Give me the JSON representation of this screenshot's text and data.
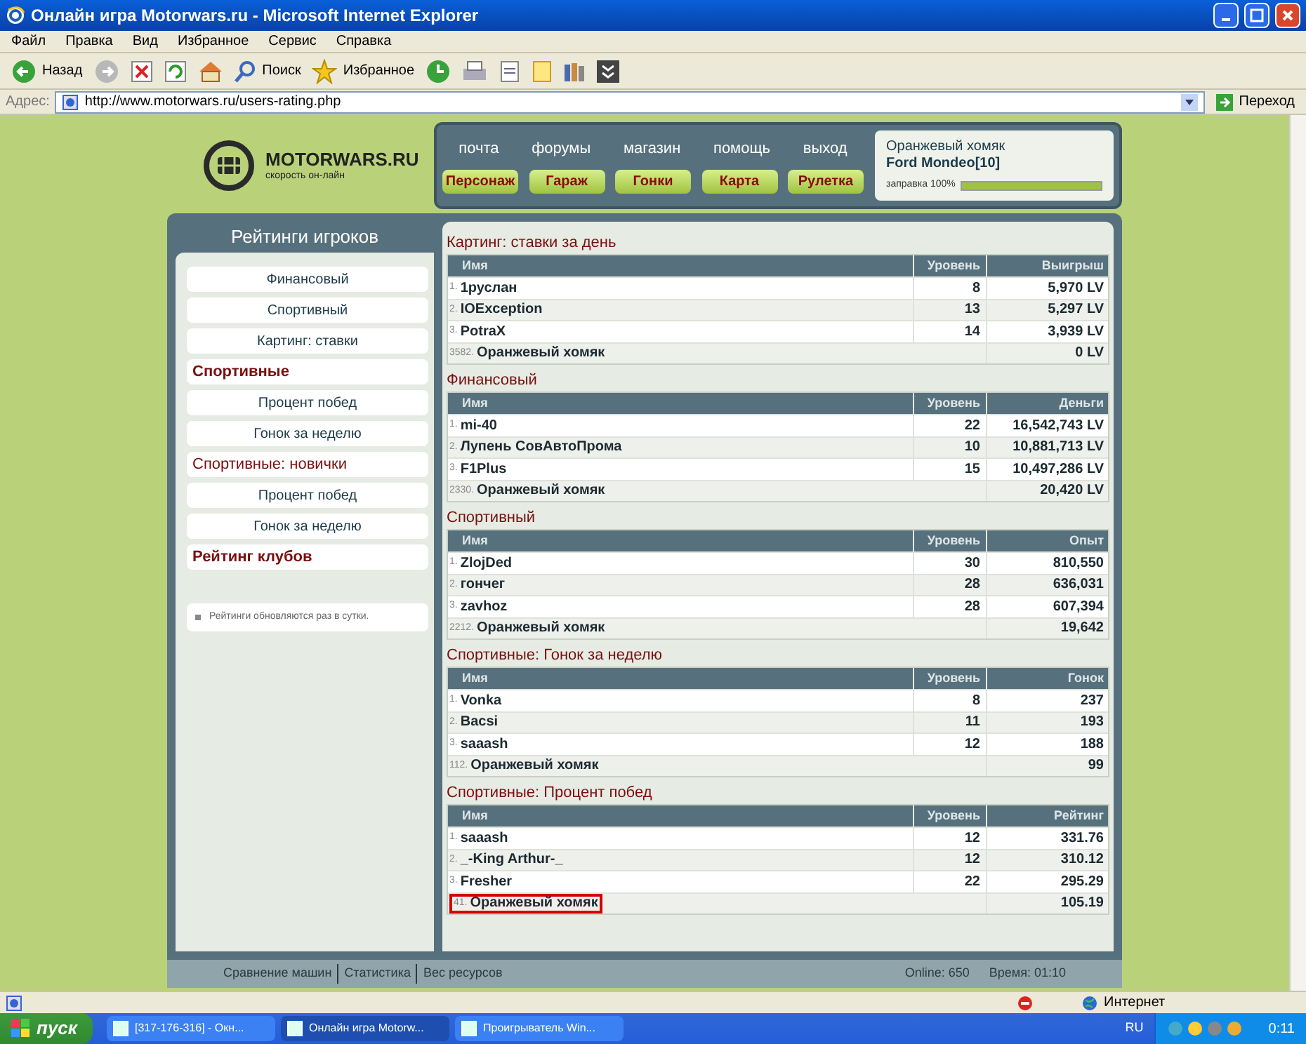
{
  "window": {
    "title": "Онлайн игра Motorwars.ru - Microsoft Internet Explorer"
  },
  "menu": [
    "Файл",
    "Правка",
    "Вид",
    "Избранное",
    "Сервис",
    "Справка"
  ],
  "toolbar": {
    "back": "Назад",
    "search": "Поиск",
    "favorites": "Избранное"
  },
  "address": {
    "label": "Адрес:",
    "url": "http://www.motorwars.ru/users-rating.php",
    "go": "Переход"
  },
  "site": {
    "logo": "MOTORWARS.RU",
    "slogan": "скорость он-лайн",
    "top_links": [
      "почта",
      "форумы",
      "магазин",
      "помощь",
      "выход"
    ],
    "buttons": [
      "Персонаж",
      "Гараж",
      "Гонки",
      "Карта",
      "Рулетка"
    ],
    "user": {
      "name": "Оранжевый хомяк",
      "car": "Ford Mondeo[10]",
      "fuel_label": "заправка 100%",
      "level": 1.0
    }
  },
  "sidebar": {
    "title": "Рейтинги игроков",
    "items": [
      {
        "label": "Финансовый",
        "kind": "link"
      },
      {
        "label": "Спортивный",
        "kind": "link"
      },
      {
        "label": "Картинг: ставки",
        "kind": "link"
      },
      {
        "label": "Спортивные",
        "kind": "group"
      },
      {
        "label": "Процент побед",
        "kind": "link"
      },
      {
        "label": "Гонок за неделю",
        "kind": "link"
      },
      {
        "label": "Спортивные: новички",
        "kind": "group"
      },
      {
        "label": "Процент побед",
        "kind": "link"
      },
      {
        "label": "Гонок за неделю",
        "kind": "link"
      },
      {
        "label": "Рейтинг клубов",
        "kind": "group"
      }
    ],
    "note": "Рейтинги обновляются раз в сутки."
  },
  "sections": [
    {
      "title": "Картинг: ставки за день",
      "columns": [
        "Имя",
        "Уровень",
        "Выигрыш"
      ],
      "rows": [
        {
          "rank": "1.",
          "name": "1руслан",
          "level": "8",
          "value": "5,970 LV",
          "highlighted": false
        },
        {
          "rank": "2.",
          "name": "IOException",
          "level": "13",
          "value": "5,297 LV",
          "highlighted": false
        },
        {
          "rank": "3.",
          "name": "PotraX",
          "level": "14",
          "value": "3,939 LV",
          "highlighted": false
        },
        {
          "rank": "3582.",
          "name": "Оранжевый хомяк",
          "value": "0 LV",
          "highlighted": false
        }
      ]
    },
    {
      "title": "Финансовый",
      "columns": [
        "Имя",
        "Уровень",
        "Деньги"
      ],
      "rows": [
        {
          "rank": "1.",
          "name": "mi-40",
          "level": "22",
          "value": "16,542,743 LV",
          "highlighted": false
        },
        {
          "rank": "2.",
          "name": "Лупень СовАвтоПрома",
          "level": "10",
          "value": "10,881,713 LV",
          "highlighted": false
        },
        {
          "rank": "3.",
          "name": "F1Plus",
          "level": "15",
          "value": "10,497,286 LV",
          "highlighted": false
        },
        {
          "rank": "2330.",
          "name": "Оранжевый хомяк",
          "value": "20,420 LV",
          "highlighted": false
        }
      ]
    },
    {
      "title": "Спортивный",
      "columns": [
        "Имя",
        "Уровень",
        "Опыт"
      ],
      "rows": [
        {
          "rank": "1.",
          "name": "ZlojDed",
          "level": "30",
          "value": "810,550",
          "highlighted": false
        },
        {
          "rank": "2.",
          "name": "гончег",
          "level": "28",
          "value": "636,031",
          "highlighted": false
        },
        {
          "rank": "3.",
          "name": "zavhoz",
          "level": "28",
          "value": "607,394",
          "highlighted": false
        },
        {
          "rank": "2212.",
          "name": "Оранжевый хомяк",
          "value": "19,642",
          "highlighted": false
        }
      ]
    },
    {
      "title": "Спортивные: Гонок за неделю",
      "columns": [
        "Имя",
        "Уровень",
        "Гонок"
      ],
      "rows": [
        {
          "rank": "1.",
          "name": "Vonka",
          "level": "8",
          "value": "237",
          "highlighted": false
        },
        {
          "rank": "2.",
          "name": "Bacsi",
          "level": "11",
          "value": "193",
          "highlighted": false
        },
        {
          "rank": "3.",
          "name": "saaash",
          "level": "12",
          "value": "188",
          "highlighted": false
        },
        {
          "rank": "112.",
          "name": "Оранжевый хомяк",
          "value": "99",
          "highlighted": false
        }
      ]
    },
    {
      "title": "Спортивные: Процент побед",
      "columns": [
        "Имя",
        "Уровень",
        "Рейтинг"
      ],
      "rows": [
        {
          "rank": "1.",
          "name": "saaash",
          "level": "12",
          "value": "331.76",
          "highlighted": false
        },
        {
          "rank": "2.",
          "name": "_-King Arthur-_",
          "level": "12",
          "value": "310.12",
          "highlighted": false
        },
        {
          "rank": "3.",
          "name": "Fresher",
          "level": "22",
          "value": "295.29",
          "highlighted": false
        },
        {
          "rank": "41.",
          "name": "Оранжевый хомяк",
          "value": "105.19",
          "highlighted": true
        }
      ]
    }
  ],
  "footer": {
    "links": [
      "Сравнение машин",
      "Статистика",
      "Вес ресурсов"
    ],
    "online": "Online: 650",
    "time": "Время: 01:10"
  },
  "status_bar": {
    "zone": "Интернет"
  },
  "taskbar": {
    "start": "пуск",
    "tasks": [
      {
        "label": "[317-176-316] - Окн...",
        "selected": false
      },
      {
        "label": "Онлайн игра Motorw...",
        "selected": true
      },
      {
        "label": "Проигрыватель Win...",
        "selected": false
      }
    ],
    "lang": "RU",
    "clock": "0:11"
  }
}
